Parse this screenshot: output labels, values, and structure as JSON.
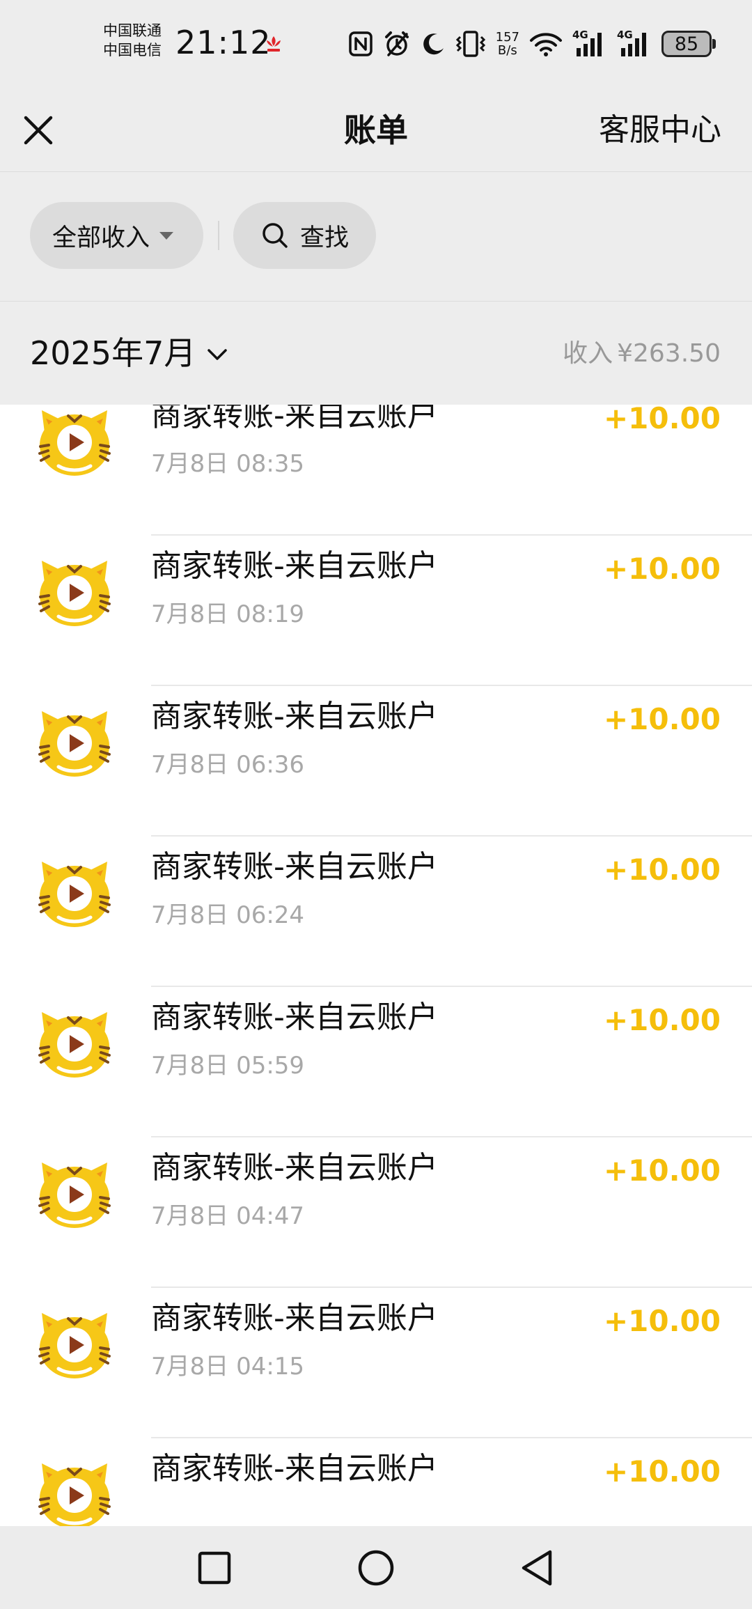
{
  "status_bar": {
    "carrier_1": "中国联通",
    "carrier_2": "中国电信",
    "time": "21:12",
    "net_speed_value": "157",
    "net_speed_unit": "B/s",
    "signal_1_type": "4G",
    "signal_2_type": "4G",
    "battery": "85",
    "icons": [
      "huawei-icon",
      "nfc-icon",
      "alarm-icon",
      "moon-icon",
      "vibrate-icon",
      "wifi-icon",
      "signal-icon",
      "signal-icon"
    ]
  },
  "header": {
    "title": "账单",
    "service_link": "客服中心",
    "close_icon": "close-icon"
  },
  "filters": {
    "type_filter_label": "全部收入",
    "search_label": "查找"
  },
  "month_bar": {
    "month_label": "2025年7月",
    "income_label": "收入",
    "income_amount": "¥263.50"
  },
  "transactions": [
    {
      "title": "商家转账-来自云账户",
      "time": "7月8日 08:35",
      "amount": "+10.00"
    },
    {
      "title": "商家转账-来自云账户",
      "time": "7月8日 08:19",
      "amount": "+10.00"
    },
    {
      "title": "商家转账-来自云账户",
      "time": "7月8日 06:36",
      "amount": "+10.00"
    },
    {
      "title": "商家转账-来自云账户",
      "time": "7月8日 06:24",
      "amount": "+10.00"
    },
    {
      "title": "商家转账-来自云账户",
      "time": "7月8日 05:59",
      "amount": "+10.00"
    },
    {
      "title": "商家转账-来自云账户",
      "time": "7月8日 04:47",
      "amount": "+10.00"
    },
    {
      "title": "商家转账-来自云账户",
      "time": "7月8日 04:15",
      "amount": "+10.00"
    },
    {
      "title": "商家转账-来自云账户",
      "time": "",
      "amount": "+10.00"
    }
  ],
  "colors": {
    "amount": "#f5be0b",
    "background": "#ededed",
    "list_background": "#ffffff",
    "secondary_text": "#a8a8a8"
  }
}
